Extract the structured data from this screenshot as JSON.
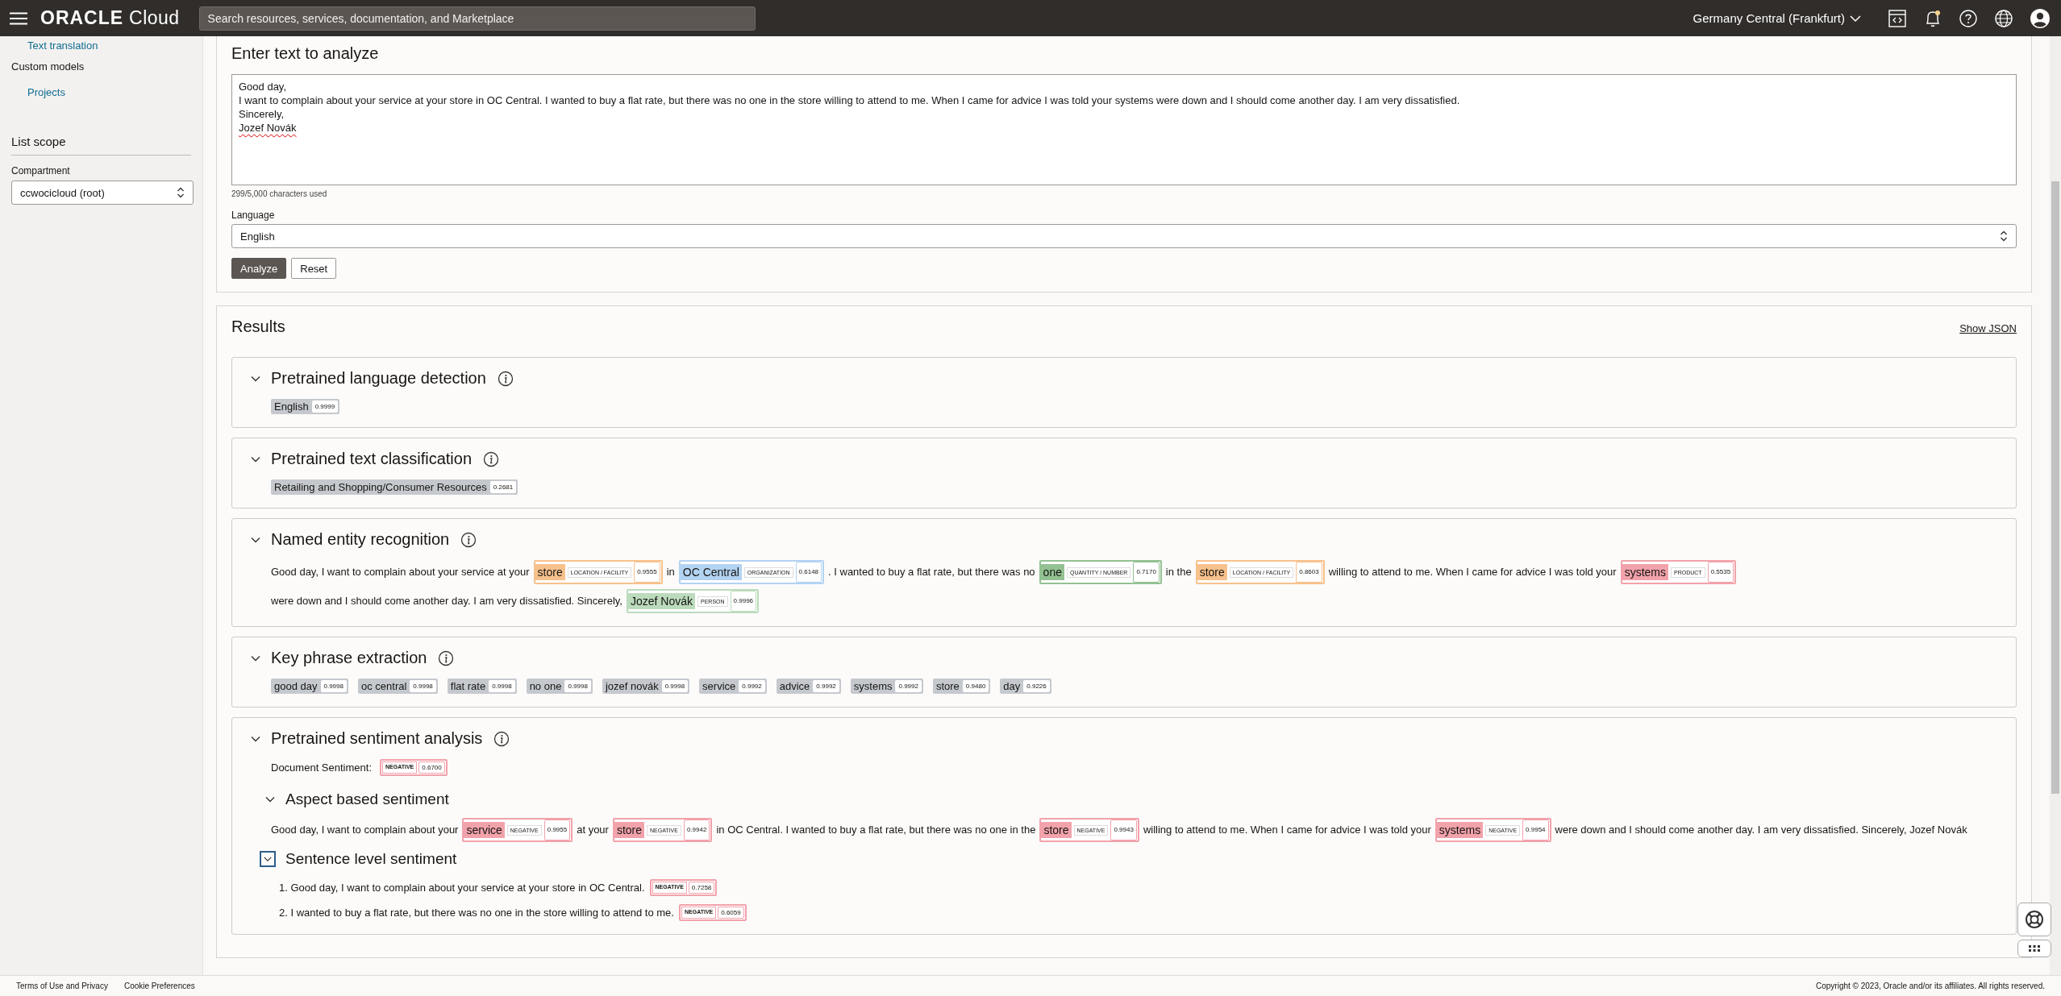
{
  "header": {
    "logo_brand": "ORACLE",
    "logo_product": "Cloud",
    "search_placeholder": "Search resources, services, documentation, and Marketplace",
    "region": "Germany Central (Frankfurt)",
    "notification_dot": true
  },
  "sidebar": {
    "items": [
      {
        "label": "Text translation",
        "kind": "link"
      },
      {
        "label": "Custom models",
        "kind": "group"
      },
      {
        "label": "Projects",
        "kind": "link"
      }
    ],
    "scope_title": "List scope",
    "compartment_label": "Compartment",
    "compartment_value": "ccwocicloud (root)"
  },
  "input_card": {
    "title": "Enter text to analyze",
    "text_lines": [
      "Good day,",
      "I want to complain about your service at your store in OC Central. I wanted to buy a flat rate, but there was no one in the store willing to attend to me. When I came for advice I was told your systems were down and I should come another day. I am very dissatisfied.",
      "Sincerely,",
      "Jozef Novák"
    ],
    "char_count": "299/5,000 characters used",
    "language_label": "Language",
    "language_value": "English",
    "buttons": [
      {
        "label": "Analyze",
        "kind": "primary"
      },
      {
        "label": "Reset",
        "kind": "secondary"
      }
    ]
  },
  "results": {
    "title": "Results",
    "show_json": "Show JSON",
    "language_detection": {
      "title": "Pretrained language detection",
      "expanded": true,
      "chips": [
        {
          "text": "English",
          "score": "0.9999"
        }
      ]
    },
    "text_classification": {
      "title": "Pretrained text classification",
      "expanded": true,
      "chips": [
        {
          "text": "Retailing and Shopping/Consumer Resources",
          "score": "0.2681"
        }
      ]
    },
    "entity_recognition": {
      "title": "Named entity recognition",
      "expanded": true,
      "segments": [
        {
          "kind": "text",
          "text": "Good day, I want to complain about your service at your"
        },
        {
          "kind": "entity",
          "text": "store",
          "type": "LOCATION / FACILITY",
          "score": "0.9555",
          "color": "#f7c18c"
        },
        {
          "kind": "text",
          "text": "in"
        },
        {
          "kind": "entity",
          "text": "OC Central",
          "type": "ORGANIZATION",
          "score": "0.6148",
          "color": "#b3d3f2"
        },
        {
          "kind": "text",
          "text": ". I wanted to buy a flat rate, but there was no"
        },
        {
          "kind": "entity",
          "text": "one",
          "type": "QUANTITY / NUMBER",
          "score": "0.7170",
          "color": "#93c192"
        },
        {
          "kind": "text",
          "text": "in the"
        },
        {
          "kind": "entity",
          "text": "store",
          "type": "LOCATION / FACILITY",
          "score": "0.8603",
          "color": "#f7c18c"
        },
        {
          "kind": "text",
          "text": "willing to attend to me. When I came for advice I was told your"
        },
        {
          "kind": "entity",
          "text": "systems",
          "type": "PRODUCT",
          "score": "0.5535",
          "color": "#f2a2ab"
        },
        {
          "kind": "text",
          "text": "were down and I should come another day. I am very dissatisfied. Sincerely,"
        },
        {
          "kind": "entity",
          "text": "Jozef Novák",
          "type": "PERSON",
          "score": "0.9996",
          "color": "#bcdbbc"
        }
      ]
    },
    "key_phrases": {
      "title": "Key phrase extraction",
      "expanded": true,
      "chips": [
        {
          "text": "good day",
          "score": "0.9998"
        },
        {
          "text": "oc central",
          "score": "0.9998"
        },
        {
          "text": "flat rate",
          "score": "0.9998"
        },
        {
          "text": "no one",
          "score": "0.9998"
        },
        {
          "text": "jozef novák",
          "score": "0.9998"
        },
        {
          "text": "service",
          "score": "0.9992"
        },
        {
          "text": "advice",
          "score": "0.9992"
        },
        {
          "text": "systems",
          "score": "0.9992"
        },
        {
          "text": "store",
          "score": "0.9480"
        },
        {
          "text": "day",
          "score": "0.9226"
        }
      ]
    },
    "sentiment": {
      "title": "Pretrained sentiment analysis",
      "expanded": true,
      "document_label": "Document Sentiment:",
      "document_sentiment": {
        "label": "NEGATIVE",
        "score": "0.6700"
      },
      "aspect": {
        "title": "Aspect based sentiment",
        "expanded": true,
        "segments": [
          {
            "kind": "text",
            "text": "Good day, I want to complain about your"
          },
          {
            "kind": "aspect",
            "text": "service",
            "label": "NEGATIVE",
            "score": "0.9955"
          },
          {
            "kind": "text",
            "text": "at your"
          },
          {
            "kind": "aspect",
            "text": "store",
            "label": "NEGATIVE",
            "score": "0.9942"
          },
          {
            "kind": "text",
            "text": "in OC Central. I wanted to buy a flat rate, but there was no one in the"
          },
          {
            "kind": "aspect",
            "text": "store",
            "label": "NEGATIVE",
            "score": "0.9943"
          },
          {
            "kind": "text",
            "text": "willing to attend to me. When I came for advice I was told your"
          },
          {
            "kind": "aspect",
            "text": "systems",
            "label": "NEGATIVE",
            "score": "0.9954"
          },
          {
            "kind": "text",
            "text": "were down and I should come another day. I am very dissatisfied. Sincerely, Jozef Novák"
          }
        ]
      },
      "sentence_level": {
        "title": "Sentence level sentiment",
        "expanded": true,
        "sentences": [
          {
            "text": "1. Good day, I want to complain about your service at your store in OC Central.",
            "label": "NEGATIVE",
            "score": "0.7258"
          },
          {
            "text": "2. I wanted to buy a flat rate, but there was no one in the store willing to attend to me.",
            "label": "NEGATIVE",
            "score": "0.6059"
          }
        ]
      }
    }
  },
  "footer": {
    "links": [
      "Terms of Use and Privacy",
      "Cookie Preferences"
    ],
    "copyright": "Copyright © 2023, Oracle and/or its affiliates. All rights reserved."
  }
}
